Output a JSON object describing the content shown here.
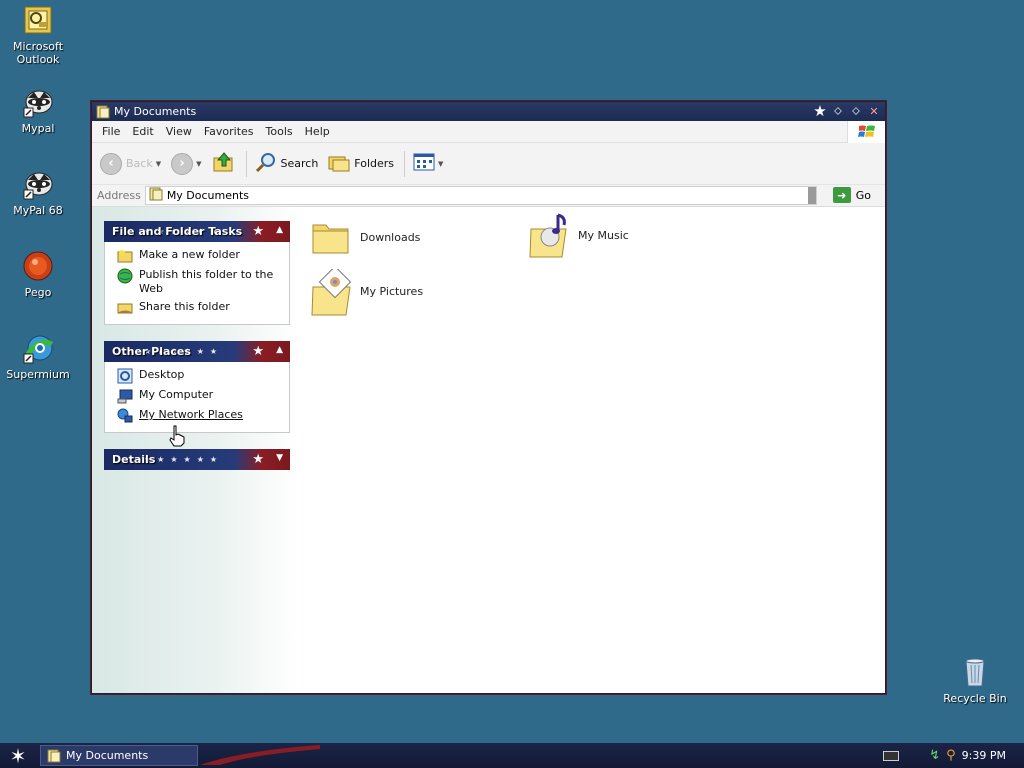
{
  "desktop": {
    "icons": [
      {
        "label": "Microsoft Outlook"
      },
      {
        "label": "Mypal"
      },
      {
        "label": "MyPal 68"
      },
      {
        "label": "Pego"
      },
      {
        "label": "Supermium"
      }
    ],
    "recycle_bin": "Recycle Bin"
  },
  "window": {
    "title": "My Documents",
    "menu": [
      "File",
      "Edit",
      "View",
      "Favorites",
      "Tools",
      "Help"
    ],
    "toolbar": {
      "back": "Back",
      "search": "Search",
      "folders": "Folders"
    },
    "address": {
      "label": "Address",
      "value": "My Documents",
      "go": "Go"
    },
    "taskpane": {
      "file_tasks": {
        "header": "File and Folder Tasks",
        "items": [
          "Make a new folder",
          "Publish this folder to the Web",
          "Share this folder"
        ]
      },
      "other_places": {
        "header": "Other Places",
        "items": [
          "Desktop",
          "My Computer",
          "My Network Places"
        ]
      },
      "details": {
        "header": "Details"
      }
    },
    "files": [
      "Downloads",
      "My Music",
      "My Pictures"
    ]
  },
  "taskbar": {
    "task": "My Documents",
    "clock": "9:39 PM"
  },
  "colors": {
    "desktop": "#2f6a8a",
    "titlebar": "#1c2b52",
    "header_blue": "#1a2a62",
    "header_red": "#8a1d24"
  }
}
